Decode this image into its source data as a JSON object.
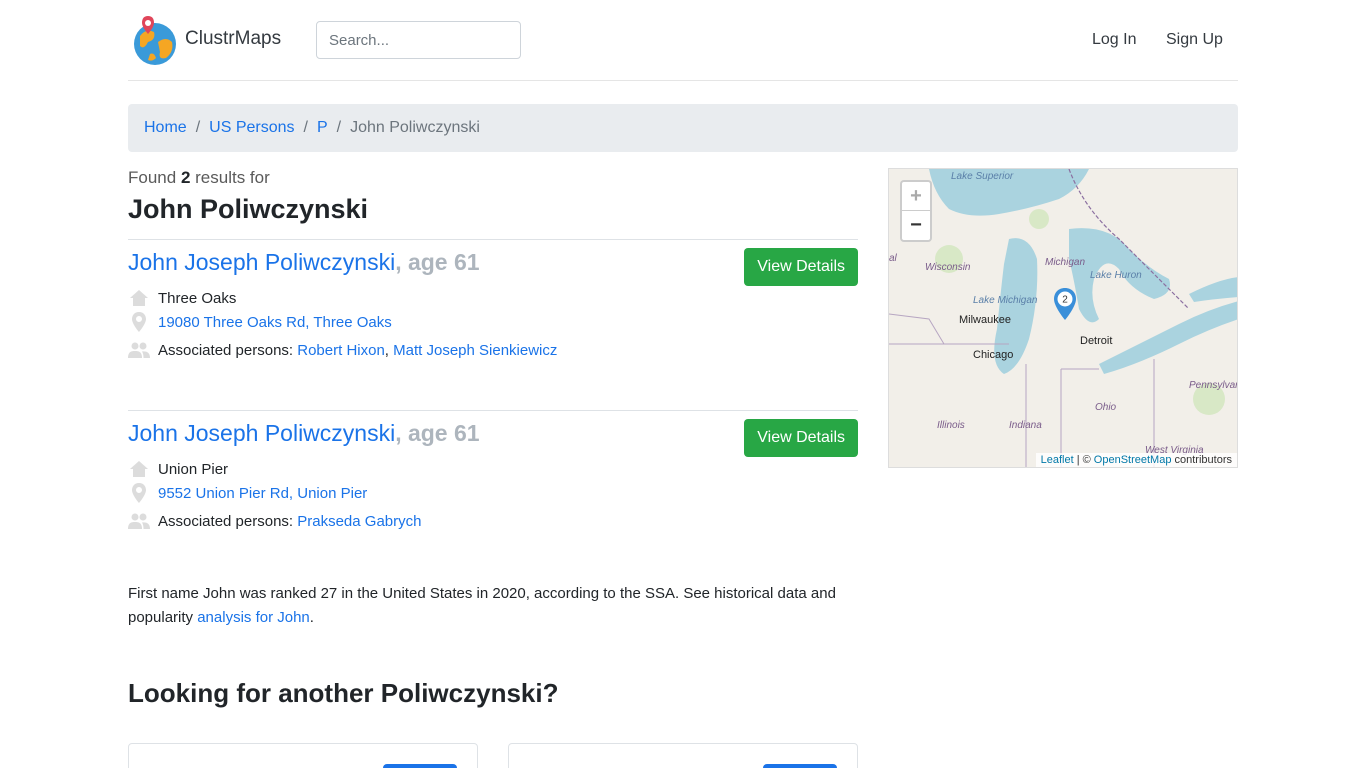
{
  "header": {
    "brand": "ClustrMaps",
    "search_placeholder": "Search...",
    "login": "Log In",
    "signup": "Sign Up"
  },
  "breadcrumb": {
    "items": [
      "Home",
      "US Persons",
      "P"
    ],
    "current": "John Poliwczynski",
    "separator": "/"
  },
  "summary": {
    "found_prefix": "Found",
    "count": "2",
    "found_suffix": "results for",
    "query": "John Poliwczynski"
  },
  "results": [
    {
      "name": "John Joseph Poliwczynski",
      "age": ", age 61",
      "button": "View Details",
      "city": "Three Oaks",
      "address": "19080 Three Oaks Rd, Three Oaks",
      "associated_label": "Associated persons:",
      "associated": [
        "Robert Hixon",
        "Matt Joseph Sienkiewicz"
      ],
      "associated_sep": ","
    },
    {
      "name": "John Joseph Poliwczynski",
      "age": ", age 61",
      "button": "View Details",
      "city": "Union Pier",
      "address": "9552 Union Pier Rd, Union Pier",
      "associated_label": "Associated persons:",
      "associated": [
        "Prakseda Gabrych"
      ]
    }
  ],
  "info": {
    "text": "First name John was ranked 27 in the United States in 2020, according to the SSA. See historical data and popularity",
    "link": "analysis for John",
    "end": "."
  },
  "another_heading": "Looking for another Poliwczynski?",
  "map": {
    "zoom_in": "+",
    "zoom_out": "−",
    "marker_count": "2",
    "attribution_leaflet": "Leaflet",
    "attribution_sep": "| ©",
    "attribution_osm": "OpenStreetMap",
    "attribution_suffix": "contributors",
    "labels": {
      "lake_superior": "Lake Superior",
      "wisconsin": "Wisconsin",
      "michigan": "Michigan",
      "lake_huron": "Lake Huron",
      "lake_michigan": "Lake Michigan",
      "milwaukee": "Milwaukee",
      "chicago": "Chicago",
      "detroit": "Detroit",
      "pennsylvania": "Pennsylvar",
      "ohio": "Ohio",
      "illinois": "Illinois",
      "indiana": "Indiana",
      "west_virginia": "West Virginia",
      "edge_l": "al"
    }
  },
  "colors": {
    "link": "#1a73e8",
    "button_green": "#28a745",
    "breadcrumb_bg": "#e9ecef",
    "water": "#aad3df",
    "land": "#f2efe9"
  }
}
